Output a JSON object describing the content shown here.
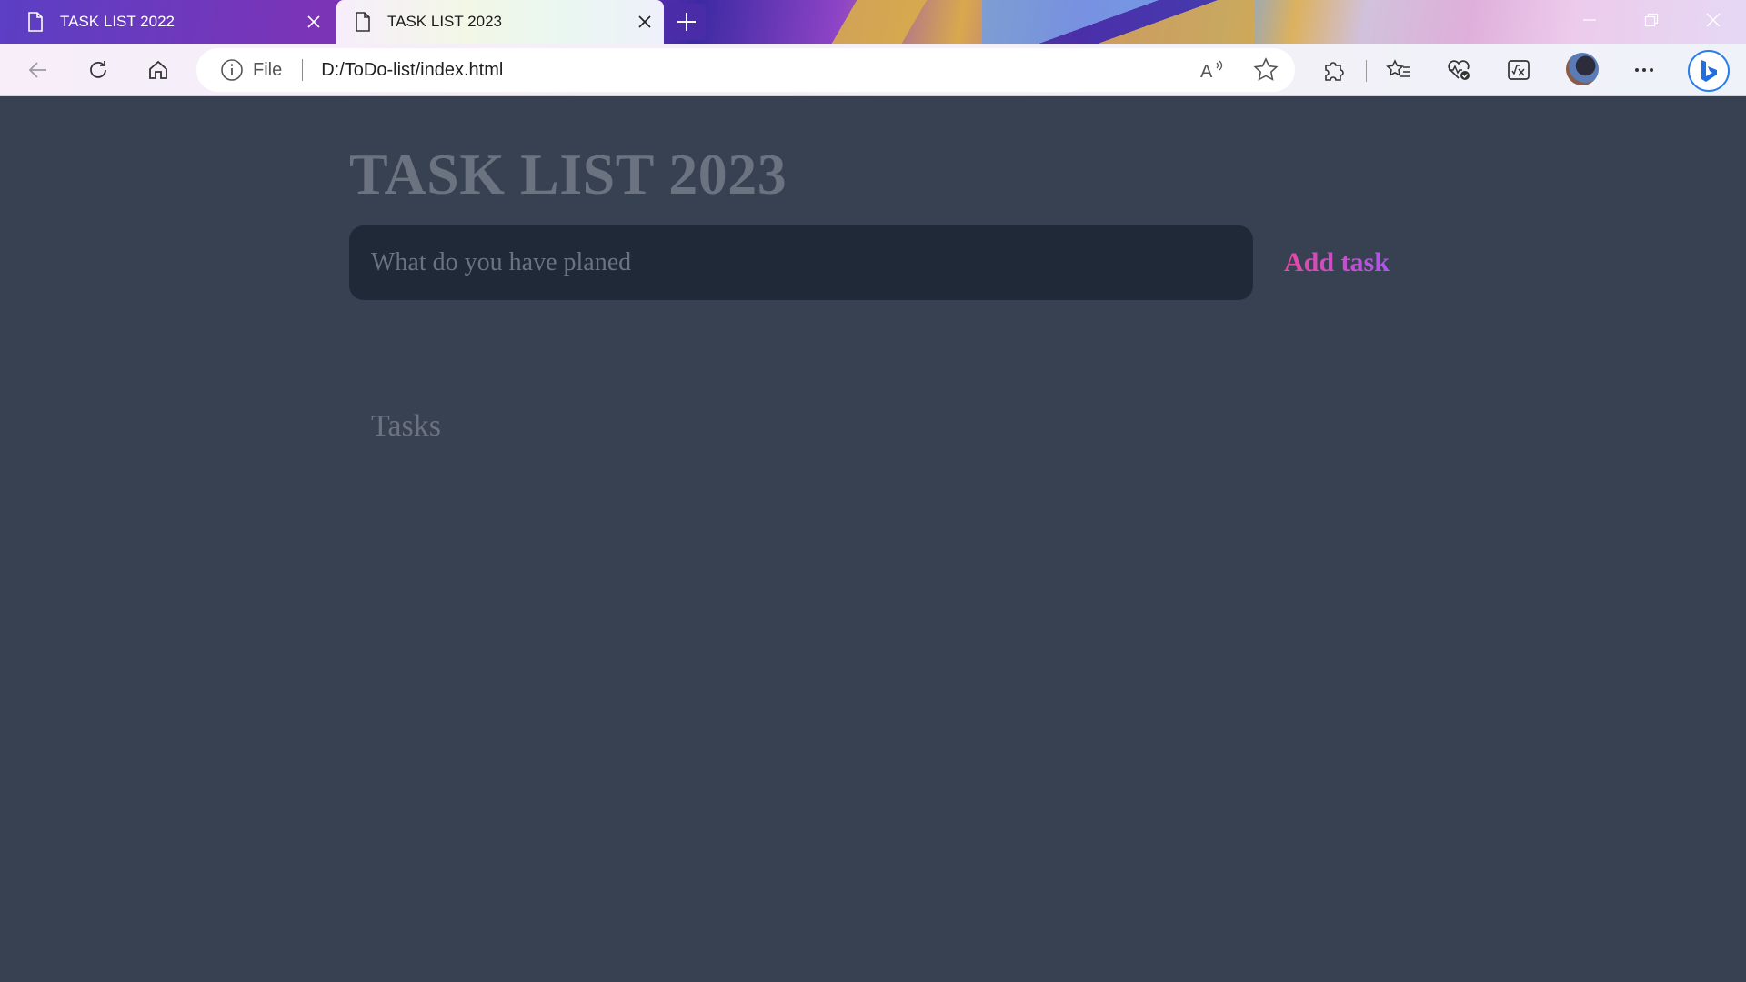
{
  "browser": {
    "tabs": [
      {
        "title": "TASK LIST 2022",
        "active": false
      },
      {
        "title": "TASK LIST 2023",
        "active": true
      }
    ],
    "address": {
      "scheme_label": "File",
      "url": "D:/ToDo-list/index.html"
    },
    "icons": {
      "back": "back-arrow-icon",
      "refresh": "refresh-icon",
      "home": "home-icon",
      "info": "info-icon",
      "read_aloud": "read-aloud-icon",
      "favorite": "star-icon",
      "extensions": "puzzle-icon",
      "favorites": "favorites-list-icon",
      "health": "browser-essentials-icon",
      "math": "math-solver-icon",
      "profile": "profile-avatar",
      "more": "more-icon",
      "copilot": "bing-copilot-icon"
    }
  },
  "app": {
    "title": "TASK LIST 2023",
    "input_placeholder": "What do you have planed",
    "input_value": "",
    "add_button_label": "Add task",
    "tasks_heading": "Tasks",
    "tasks": [],
    "colors": {
      "background": "#374151",
      "input_background": "#1f2937",
      "muted_text": "#6b7280",
      "accent_start": "#ec4899",
      "accent_end": "#a855f7"
    }
  }
}
